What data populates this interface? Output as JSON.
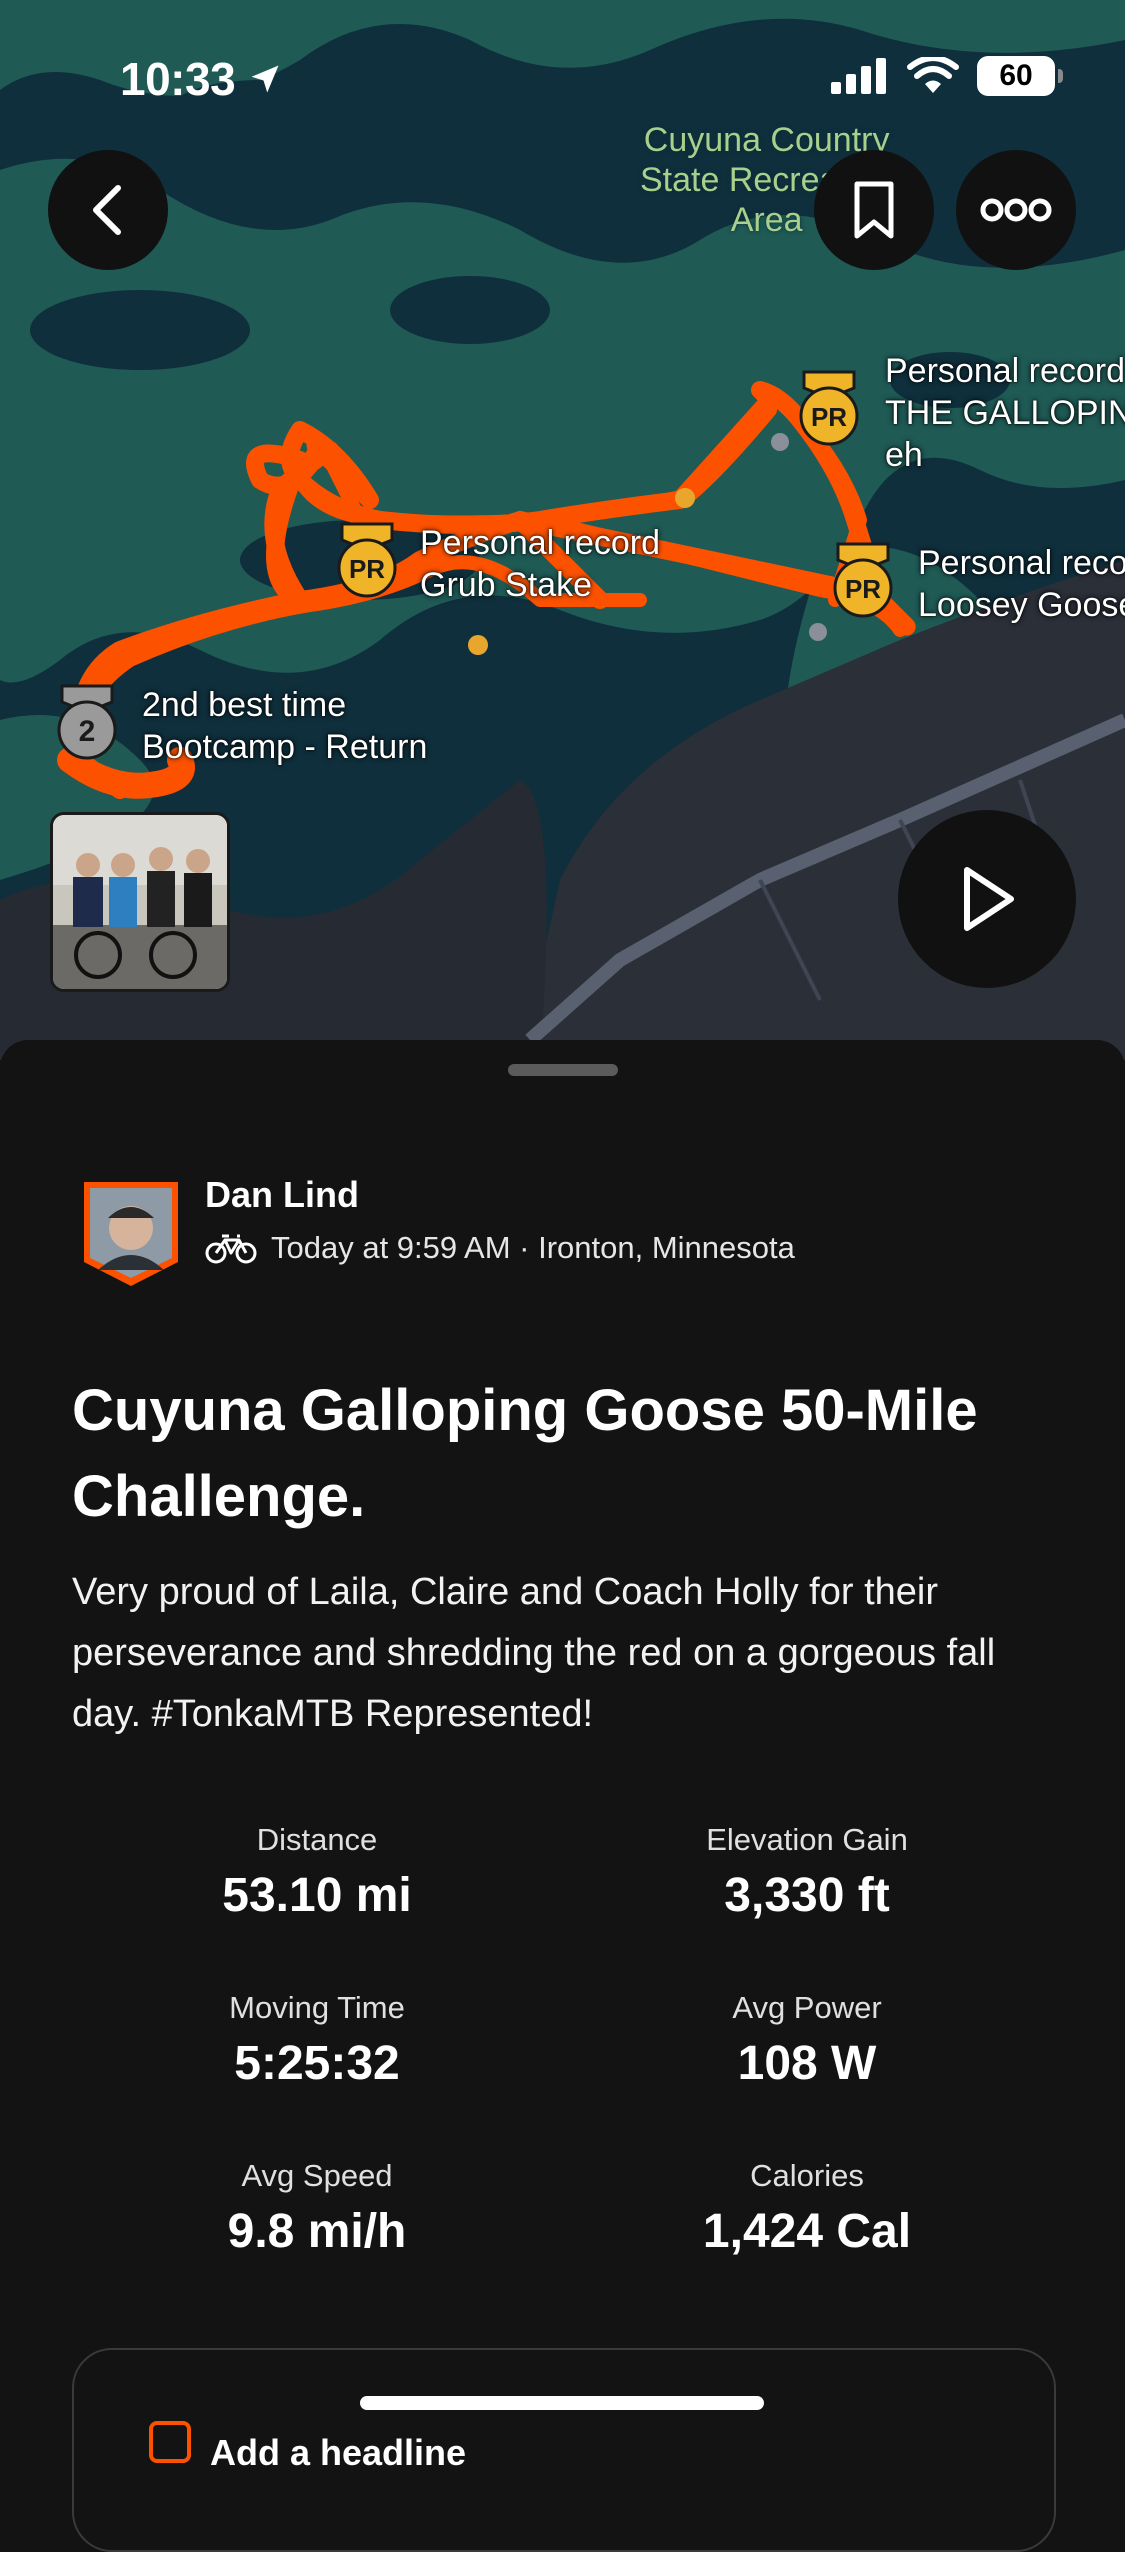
{
  "status_bar": {
    "time": "10:33",
    "battery": "60"
  },
  "map": {
    "park_label": [
      "Cuyuna Country",
      "State Recreation",
      "Area"
    ],
    "segments": [
      {
        "badge": "PR",
        "lines": [
          "Personal record",
          "THE GALLOPING",
          "eh"
        ]
      },
      {
        "badge": "PR",
        "lines": [
          "Personal record",
          "Grub Stake"
        ]
      },
      {
        "badge": "PR",
        "lines": [
          "Personal record",
          "Loosey Goose"
        ]
      },
      {
        "badge": "2",
        "lines": [
          "2nd best time",
          "Bootcamp - Return"
        ]
      }
    ],
    "colors": {
      "route": "#fc5200",
      "water": "#0f2f3c",
      "land": "#1f5a55",
      "badge": "#f0b428"
    }
  },
  "activity": {
    "athlete": "Dan Lind",
    "meta": "Today at 9:59 AM · Ironton, Minnesota",
    "title": "Cuyuna Galloping Goose 50-Mile Challenge.",
    "description": "Very proud of Laila, Claire and Coach Holly for their perseverance and shredding the red on a gorgeous fall day. #TonkaMTB Represented!",
    "stats": [
      {
        "label": "Distance",
        "value": "53.10 mi"
      },
      {
        "label": "Elevation Gain",
        "value": "3,330 ft"
      },
      {
        "label": "Moving Time",
        "value": "5:25:32"
      },
      {
        "label": "Avg Power",
        "value": "108 W"
      },
      {
        "label": "Avg Speed",
        "value": "9.8 mi/h"
      },
      {
        "label": "Calories",
        "value": "1,424 Cal"
      }
    ],
    "card_label": "Add a headline"
  }
}
